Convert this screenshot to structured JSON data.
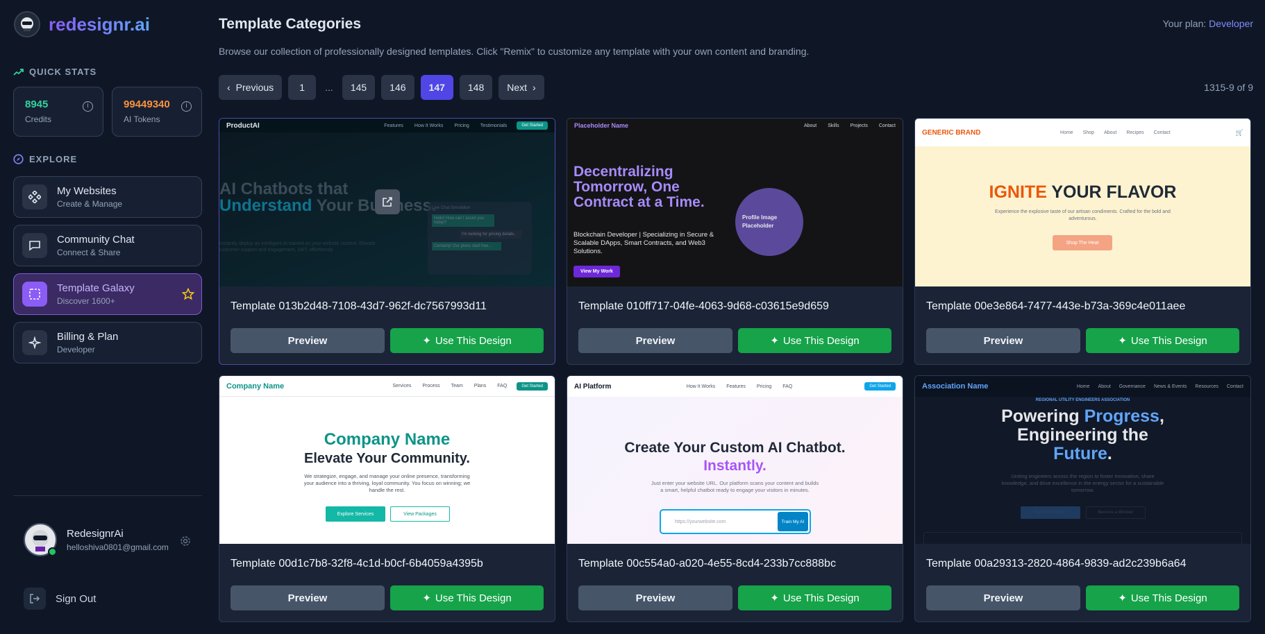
{
  "brand": {
    "name": "redesignr.ai"
  },
  "quick_stats": {
    "heading": "QUICK STATS",
    "credits_value": "8945",
    "credits_label": "Credits",
    "tokens_value": "99449340",
    "tokens_label": "AI Tokens",
    "credits_color": "#34d399",
    "tokens_color": "#fb923c"
  },
  "explore": {
    "heading": "EXPLORE",
    "items": [
      {
        "label": "My Websites",
        "sub": "Create & Manage"
      },
      {
        "label": "Community Chat",
        "sub": "Connect & Share"
      },
      {
        "label": "Template Galaxy",
        "sub": "Discover 1600+"
      },
      {
        "label": "Billing & Plan",
        "sub": "Developer"
      }
    ]
  },
  "user": {
    "name": "RedesignrAi",
    "email": "helloshiva0801@gmail.com",
    "sign_out": "Sign Out"
  },
  "header": {
    "title": "Template Categories",
    "description": "Browse our collection of professionally designed templates. Click \"Remix\" to customize any template with your own content and branding.",
    "plan_label": "Your plan:",
    "plan_value": "Developer"
  },
  "pagination": {
    "prev": "Previous",
    "first": "1",
    "ellipsis": "...",
    "pages": [
      "145",
      "146",
      "147",
      "148"
    ],
    "current": "147",
    "next": "Next",
    "range": "1315-9 of 9"
  },
  "card_actions": {
    "preview": "Preview",
    "use": "Use This Design"
  },
  "cards": [
    {
      "name": "Template 013b2d48-7108-43d7-962f-dc7567993d11",
      "brand": "ProductAI",
      "links": [
        "Features",
        "How It Works",
        "Pricing",
        "Testimonials"
      ],
      "cta": "Get Started",
      "headline1": "AI Chatbots that",
      "headline2": "Understand",
      "headline3": "Your Business.",
      "body": "Instantly deploy an intelligent AI trained on your website content. Elevate customer support and engagement, 24/7, effortlessly.",
      "chat_title": "Live Chat Simulation",
      "chat1": "Hello! How can I assist you today?",
      "chat2": "I'm looking for pricing details.",
      "chat3": "Certainly! Our plans start free..."
    },
    {
      "name": "Template 010ff717-04fe-4063-9d68-c03615e9d659",
      "brand": "Placeholder Name",
      "links": [
        "About",
        "Skills",
        "Projects",
        "Contact"
      ],
      "headline": "Decentralizing Tomorrow, One Contract at a Time.",
      "body": "Blockchain Developer | Specializing in Secure & Scalable DApps, Smart Contracts, and Web3 Solutions.",
      "cta": "View My Work",
      "circle": "Profile Image Placeholder"
    },
    {
      "name": "Template 00e3e864-7477-443e-b73a-369c4e011aee",
      "brand": "GENERIC BRAND",
      "links": [
        "Home",
        "Shop",
        "About",
        "Recipes",
        "Contact"
      ],
      "headline1": "IGNITE",
      "headline2": "YOUR FLAVOR",
      "body": "Experience the explosive taste of our artisan condiments. Crafted for the bold and adventurous.",
      "cta": "Shop The Heat"
    },
    {
      "name": "Template 00d1c7b8-32f8-4c1d-b0cf-6b4059a4395b",
      "brand": "Company Name",
      "links": [
        "Services",
        "Process",
        "Team",
        "Plans",
        "FAQ"
      ],
      "cta": "Get Started",
      "headline1": "Company Name",
      "headline2": "Elevate Your Community.",
      "body": "We strategize, engage, and manage your online presence, transforming your audience into a thriving, loyal community. You focus on winning; we handle the rest.",
      "btn1": "Explore Services",
      "btn2": "View Packages"
    },
    {
      "name": "Template 00c554a0-a020-4e55-8cd4-233b7cc888bc",
      "brand": "AI Platform",
      "links": [
        "How It Works",
        "Features",
        "Pricing",
        "FAQ"
      ],
      "cta": "Get Started",
      "headline1": "Create Your Custom AI Chatbot.",
      "headline2": "Instantly.",
      "body": "Just enter your website URL. Our platform scans your content and builds a smart, helpful chatbot ready to engage your visitors in minutes.",
      "input": "https://yourwebsite.com",
      "btn": "Train My AI"
    },
    {
      "name": "Template 00a29313-2820-4864-9839-ad2c239b6a64",
      "brand": "Association Name",
      "links": [
        "Home",
        "About",
        "Governance",
        "News & Events",
        "Resources",
        "Contact"
      ],
      "kicker": "REGIONAL UTILITY ENGINEERS ASSOCIATION",
      "h1a": "Powering",
      "h1b": "Progress",
      "h1c": ",",
      "h2": "Engineering the",
      "h3": "Future",
      "h3b": ".",
      "body": "Uniting engineers across the region to foster innovation, share knowledge, and drive excellence in the energy sector for a sustainable tomorrow.",
      "btn1": "Explore Initiatives",
      "btn2": "Become a Member"
    }
  ]
}
